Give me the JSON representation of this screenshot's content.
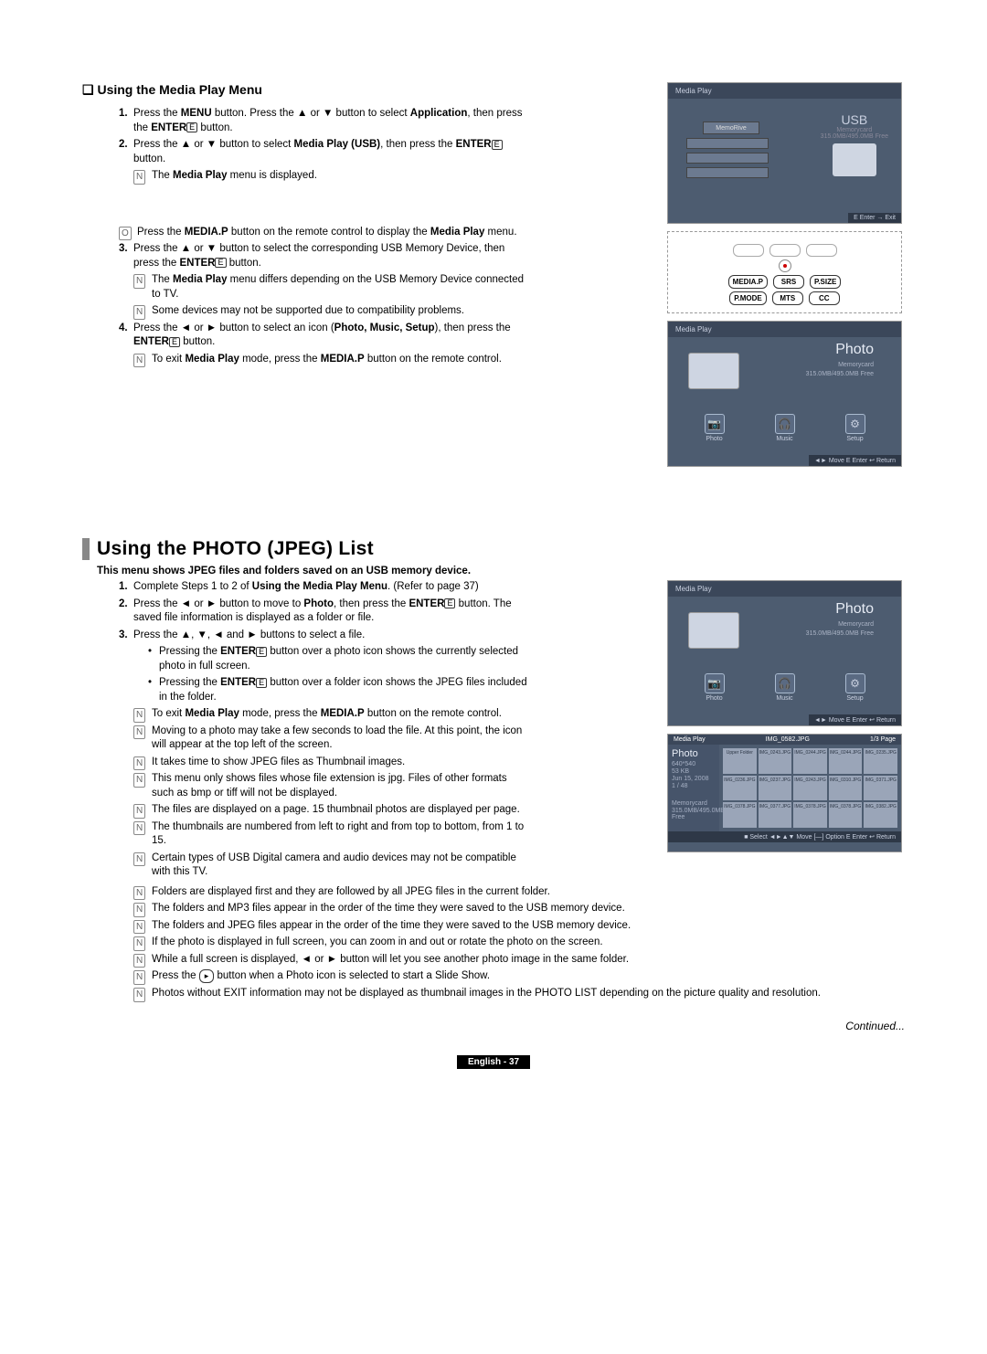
{
  "section1": {
    "heading": "Using the Media Play Menu",
    "step1": {
      "num": "1.",
      "text": "Press the MENU button. Press the ▲ or ▼ button to select Application, then press the ENTER"
    },
    "step1_tail": " button.",
    "step2": {
      "num": "2.",
      "text": "Press the ▲ or ▼ button to select Media Play (USB), then press the ENTER"
    },
    "step2_tail": "button.",
    "note2a": "The Media Play menu is displayed.",
    "icon_note": "Press the MEDIA.P button on the remote control to display the Media Play menu.",
    "step3": {
      "num": "3.",
      "text": "Press the ▲ or ▼ button to select the corresponding USB Memory Device, then press the ENTER"
    },
    "step3_tail": " button.",
    "note3a": "The Media Play menu differs depending on the USB Memory Device connected to TV.",
    "note3b": "Some devices may not be supported due to compatibility problems.",
    "step4": {
      "num": "4.",
      "text": "Press the ◄ or ► button to select an icon (Photo, Music, Setup), then press the  ENTER"
    },
    "step4_tail": " button.",
    "note4a": "To exit Media Play mode, press the MEDIA.P button on the remote control."
  },
  "screen1": {
    "header": "Media Play",
    "memodrive": "MemoRive",
    "usb": "USB",
    "usb_sub1": "Memorycard",
    "usb_sub2": "315.0MB/495.0MB Free",
    "footer": "E Enter   → Exit"
  },
  "remote": {
    "buttons": [
      "MEDIA.P",
      "SRS",
      "P.SIZE",
      "P.MODE",
      "MTS",
      "CC"
    ]
  },
  "screen2": {
    "header": "Media Play",
    "title": "Photo",
    "sub1": "Memorycard",
    "sub2": "315.0MB/495.0MB Free",
    "icons": [
      "Photo",
      "Music",
      "Setup"
    ],
    "footer": "◄► Move   E Enter   ↩ Return"
  },
  "section2": {
    "heading": "Using the PHOTO (JPEG) List",
    "intro": "This menu shows JPEG files and folders saved on an USB memory device.",
    "step1": {
      "num": "1.",
      "text": "Complete Steps 1 to 2 of Using the Media Play Menu. (Refer to page 37)"
    },
    "step2": {
      "num": "2.",
      "text": "Press the ◄ or ► button to move to Photo, then press the ENTER"
    },
    "step2_tail": " button. The saved file information is displayed as a folder or file.",
    "step3": {
      "num": "3.",
      "text": "Press the ▲, ▼, ◄ and ► buttons to select a file."
    },
    "bullet_a": "Pressing the ENTER",
    "bullet_a_tail": " button over a photo icon shows the currently selected photo in full screen.",
    "bullet_b": "Pressing the ENTER",
    "bullet_b_tail": " button over a folder icon shows the JPEG files included in the folder.",
    "notes": [
      "To exit Media Play mode, press the MEDIA.P button on the remote control.",
      "Moving to a photo may take a few seconds to load the file. At this point, the icon will appear at the top left of the screen.",
      "It takes time to show JPEG files as Thumbnail images.",
      "This menu only shows files whose file extension is jpg. Files of other formats such as bmp or tiff will not be displayed.",
      "The files are displayed on a page. 15 thumbnail photos are displayed per page.",
      "The thumbnails are numbered from left to right and from top to bottom, from 1 to 15.",
      "Certain types of USB Digital camera and audio devices may not be compatible with this TV.",
      "Folders are displayed first and they are followed by all JPEG files in the current folder.",
      "The folders and MP3 files appear in the order of the time they were saved to the USB memory device.",
      "The folders and JPEG files appear in the order of the time they were saved to the USB memory device.",
      "If the photo is displayed in full screen, you can zoom in and out or rotate the photo on the screen.",
      "While a full screen is displayed, ◄ or ► button will let you see another photo image in the same folder.",
      "Press the",
      "Photos without EXIT information may not be displayed as thumbnail images in the PHOTO LIST depending on the picture quality and resolution."
    ],
    "note_play_tail": " button when a Photo icon is selected to start a Slide Show."
  },
  "screen3": {
    "header": "Media Play",
    "title": "Photo",
    "sub1": "Memorycard",
    "sub2": "315.0MB/495.0MB Free",
    "icons": [
      "Photo",
      "Music",
      "Setup"
    ],
    "footer": "◄► Move   E Enter   ↩ Return"
  },
  "screen4": {
    "header_left": "Media Play",
    "header_file": "IMG_0582.JPG",
    "header_page": "1/3 Page",
    "left_title": "Photo",
    "left_info": [
      "640*540",
      "53 KB",
      "Jun 15, 2008",
      "1 / 48"
    ],
    "left_card": "Memorycard",
    "left_free": "315.0MB/495.0MB Free",
    "cells": [
      "Upper Folder",
      "IMG_0243.JPG",
      "IMG_0244.JPG",
      "IMG_0244.JPG",
      "IMG_0235.JPG",
      "IMG_0236.JPG",
      "IMG_0237.JPG",
      "IMG_0243.JPG",
      "IMG_0310.JPG",
      "IMG_0371.JPG",
      "IMG_0378.JPG",
      "IMG_0377.JPG",
      "IMG_0378.JPG",
      "IMG_0378.JPG",
      "IMG_0382.JPG"
    ],
    "footer": "■ Select   ◄►▲▼ Move   [—] Option   E Enter   ↩ Return"
  },
  "continued": "Continued...",
  "page_num": "English - 37"
}
